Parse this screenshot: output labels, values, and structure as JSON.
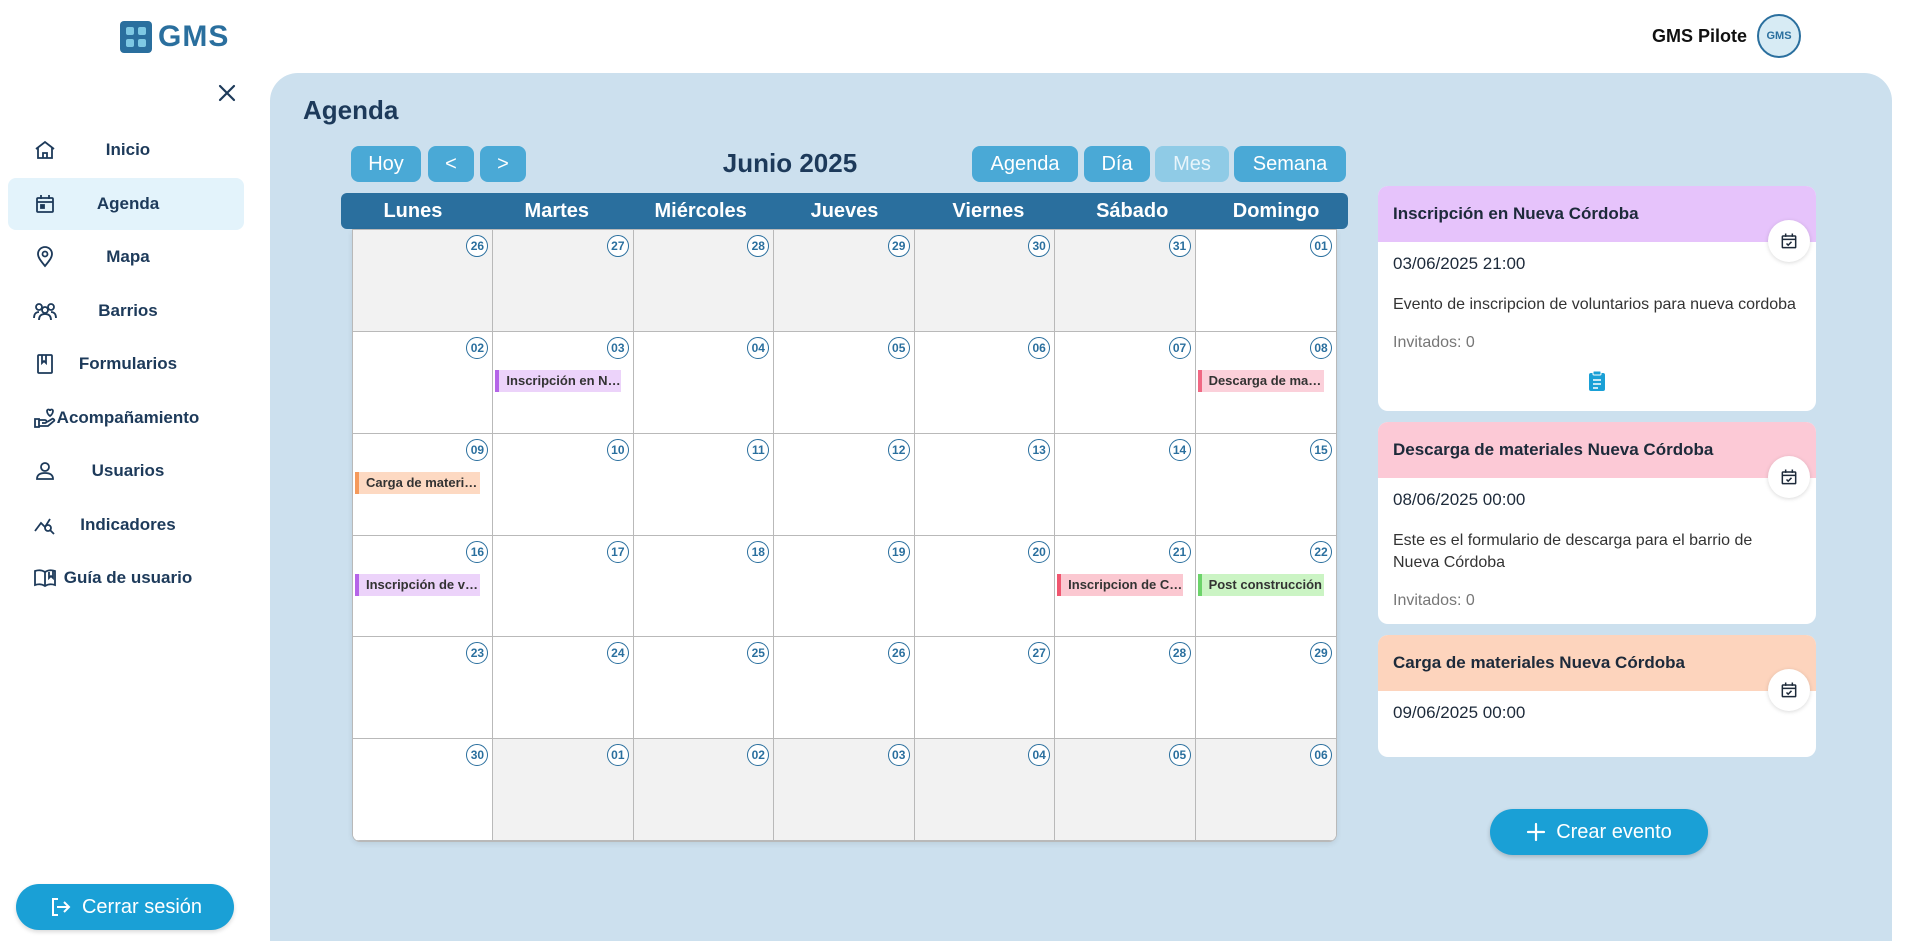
{
  "app": {
    "logo_text": "GMS"
  },
  "header": {
    "user_name": "GMS Pilote",
    "avatar_text": "GMS"
  },
  "sidebar": {
    "items": [
      {
        "label": "Inicio",
        "icon": "home-icon"
      },
      {
        "label": "Agenda",
        "icon": "calendar-icon",
        "active": true
      },
      {
        "label": "Mapa",
        "icon": "map-pin-icon"
      },
      {
        "label": "Barrios",
        "icon": "community-icon"
      },
      {
        "label": "Formularios",
        "icon": "book-icon"
      },
      {
        "label": "Acompañamiento",
        "icon": "care-hand-icon"
      },
      {
        "label": "Usuarios",
        "icon": "user-icon"
      },
      {
        "label": "Indicadores",
        "icon": "chart-search-icon"
      },
      {
        "label": "Guía de usuario",
        "icon": "open-book-icon"
      }
    ],
    "logout_label": "Cerrar sesión"
  },
  "page": {
    "title": "Agenda"
  },
  "toolbar": {
    "today": "Hoy",
    "prev": "<",
    "next": ">",
    "month_title": "Junio 2025",
    "views": [
      "Agenda",
      "Día",
      "Mes",
      "Semana"
    ],
    "selected_view": "Mes"
  },
  "calendar": {
    "weekdays": [
      "Lunes",
      "Martes",
      "Miércoles",
      "Jueves",
      "Viernes",
      "Sábado",
      "Domingo"
    ],
    "days": [
      {
        "n": "26",
        "off": true
      },
      {
        "n": "27",
        "off": true
      },
      {
        "n": "28",
        "off": true
      },
      {
        "n": "29",
        "off": true
      },
      {
        "n": "30",
        "off": true
      },
      {
        "n": "31",
        "off": true
      },
      {
        "n": "01"
      },
      {
        "n": "02"
      },
      {
        "n": "03",
        "event": "Inscripción en Nueva Córdoba",
        "color": "#b565e8",
        "bg": "#ecd3fa"
      },
      {
        "n": "04"
      },
      {
        "n": "05"
      },
      {
        "n": "06"
      },
      {
        "n": "07"
      },
      {
        "n": "08",
        "event": "Descarga de materiales Nueva Córdoba",
        "color": "#f06883",
        "bg": "#fbd0da"
      },
      {
        "n": "09",
        "event": "Carga de materiales Nueva Córdoba",
        "color": "#f59a5c",
        "bg": "#fdd9c2"
      },
      {
        "n": "10"
      },
      {
        "n": "11"
      },
      {
        "n": "12"
      },
      {
        "n": "13"
      },
      {
        "n": "14"
      },
      {
        "n": "15"
      },
      {
        "n": "16",
        "event": "Inscripción de voluntarios",
        "color": "#b565e8",
        "bg": "#ecd3fa"
      },
      {
        "n": "17"
      },
      {
        "n": "18"
      },
      {
        "n": "19"
      },
      {
        "n": "20"
      },
      {
        "n": "21",
        "event": "Inscripcion de Córdoba",
        "color": "#f0566f",
        "bg": "#fbc8d1"
      },
      {
        "n": "22",
        "event": "Post construcción",
        "color": "#6cd36a",
        "bg": "#cbf4c4"
      },
      {
        "n": "23"
      },
      {
        "n": "24"
      },
      {
        "n": "25"
      },
      {
        "n": "26"
      },
      {
        "n": "27"
      },
      {
        "n": "28"
      },
      {
        "n": "29"
      },
      {
        "n": "30"
      },
      {
        "n": "01",
        "off": true
      },
      {
        "n": "02",
        "off": true
      },
      {
        "n": "03",
        "off": true
      },
      {
        "n": "04",
        "off": true
      },
      {
        "n": "05",
        "off": true
      },
      {
        "n": "06",
        "off": true
      }
    ]
  },
  "events": [
    {
      "title": "Inscripción en Nueva Córdoba",
      "date": "03/06/2025 21:00",
      "description": "Evento de inscripcion de voluntarios para nueva cordoba",
      "invited": "Invitados: 0",
      "header_color": "#e6c3fb",
      "has_form": true
    },
    {
      "title": "Descarga de materiales Nueva Córdoba",
      "date": "08/06/2025 00:00",
      "description": "Este es el formulario de descarga para el barrio de Nueva Córdoba",
      "invited": "Invitados: 0",
      "header_color": "#fcc9d6"
    },
    {
      "title": "Carga de materiales Nueva Córdoba",
      "date": "09/06/2025 00:00",
      "header_color": "#fdd4bd"
    }
  ],
  "create_event_label": "Crear evento"
}
